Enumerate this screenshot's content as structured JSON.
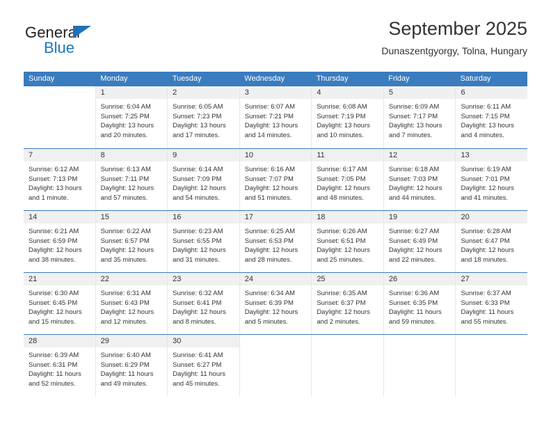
{
  "brand": {
    "name_part1": "General",
    "name_part2": "Blue",
    "triangle_icon": "triangle-icon",
    "accent_color": "#1878c4"
  },
  "header": {
    "title": "September 2025",
    "subtitle": "Dunaszentgyorgy, Tolna, Hungary"
  },
  "colors": {
    "header_blue": "#3a7cbe",
    "day_number_band": "#f0f0f0",
    "grid_line": "#e6e6e6",
    "text": "#333333"
  },
  "weekdays": [
    "Sunday",
    "Monday",
    "Tuesday",
    "Wednesday",
    "Thursday",
    "Friday",
    "Saturday"
  ],
  "weeks": [
    [
      {
        "day": "",
        "lines": []
      },
      {
        "day": "1",
        "lines": [
          "Sunrise: 6:04 AM",
          "Sunset: 7:25 PM",
          "Daylight: 13 hours",
          "and 20 minutes."
        ]
      },
      {
        "day": "2",
        "lines": [
          "Sunrise: 6:05 AM",
          "Sunset: 7:23 PM",
          "Daylight: 13 hours",
          "and 17 minutes."
        ]
      },
      {
        "day": "3",
        "lines": [
          "Sunrise: 6:07 AM",
          "Sunset: 7:21 PM",
          "Daylight: 13 hours",
          "and 14 minutes."
        ]
      },
      {
        "day": "4",
        "lines": [
          "Sunrise: 6:08 AM",
          "Sunset: 7:19 PM",
          "Daylight: 13 hours",
          "and 10 minutes."
        ]
      },
      {
        "day": "5",
        "lines": [
          "Sunrise: 6:09 AM",
          "Sunset: 7:17 PM",
          "Daylight: 13 hours",
          "and 7 minutes."
        ]
      },
      {
        "day": "6",
        "lines": [
          "Sunrise: 6:11 AM",
          "Sunset: 7:15 PM",
          "Daylight: 13 hours",
          "and 4 minutes."
        ]
      }
    ],
    [
      {
        "day": "7",
        "lines": [
          "Sunrise: 6:12 AM",
          "Sunset: 7:13 PM",
          "Daylight: 13 hours",
          "and 1 minute."
        ]
      },
      {
        "day": "8",
        "lines": [
          "Sunrise: 6:13 AM",
          "Sunset: 7:11 PM",
          "Daylight: 12 hours",
          "and 57 minutes."
        ]
      },
      {
        "day": "9",
        "lines": [
          "Sunrise: 6:14 AM",
          "Sunset: 7:09 PM",
          "Daylight: 12 hours",
          "and 54 minutes."
        ]
      },
      {
        "day": "10",
        "lines": [
          "Sunrise: 6:16 AM",
          "Sunset: 7:07 PM",
          "Daylight: 12 hours",
          "and 51 minutes."
        ]
      },
      {
        "day": "11",
        "lines": [
          "Sunrise: 6:17 AM",
          "Sunset: 7:05 PM",
          "Daylight: 12 hours",
          "and 48 minutes."
        ]
      },
      {
        "day": "12",
        "lines": [
          "Sunrise: 6:18 AM",
          "Sunset: 7:03 PM",
          "Daylight: 12 hours",
          "and 44 minutes."
        ]
      },
      {
        "day": "13",
        "lines": [
          "Sunrise: 6:19 AM",
          "Sunset: 7:01 PM",
          "Daylight: 12 hours",
          "and 41 minutes."
        ]
      }
    ],
    [
      {
        "day": "14",
        "lines": [
          "Sunrise: 6:21 AM",
          "Sunset: 6:59 PM",
          "Daylight: 12 hours",
          "and 38 minutes."
        ]
      },
      {
        "day": "15",
        "lines": [
          "Sunrise: 6:22 AM",
          "Sunset: 6:57 PM",
          "Daylight: 12 hours",
          "and 35 minutes."
        ]
      },
      {
        "day": "16",
        "lines": [
          "Sunrise: 6:23 AM",
          "Sunset: 6:55 PM",
          "Daylight: 12 hours",
          "and 31 minutes."
        ]
      },
      {
        "day": "17",
        "lines": [
          "Sunrise: 6:25 AM",
          "Sunset: 6:53 PM",
          "Daylight: 12 hours",
          "and 28 minutes."
        ]
      },
      {
        "day": "18",
        "lines": [
          "Sunrise: 6:26 AM",
          "Sunset: 6:51 PM",
          "Daylight: 12 hours",
          "and 25 minutes."
        ]
      },
      {
        "day": "19",
        "lines": [
          "Sunrise: 6:27 AM",
          "Sunset: 6:49 PM",
          "Daylight: 12 hours",
          "and 22 minutes."
        ]
      },
      {
        "day": "20",
        "lines": [
          "Sunrise: 6:28 AM",
          "Sunset: 6:47 PM",
          "Daylight: 12 hours",
          "and 18 minutes."
        ]
      }
    ],
    [
      {
        "day": "21",
        "lines": [
          "Sunrise: 6:30 AM",
          "Sunset: 6:45 PM",
          "Daylight: 12 hours",
          "and 15 minutes."
        ]
      },
      {
        "day": "22",
        "lines": [
          "Sunrise: 6:31 AM",
          "Sunset: 6:43 PM",
          "Daylight: 12 hours",
          "and 12 minutes."
        ]
      },
      {
        "day": "23",
        "lines": [
          "Sunrise: 6:32 AM",
          "Sunset: 6:41 PM",
          "Daylight: 12 hours",
          "and 8 minutes."
        ]
      },
      {
        "day": "24",
        "lines": [
          "Sunrise: 6:34 AM",
          "Sunset: 6:39 PM",
          "Daylight: 12 hours",
          "and 5 minutes."
        ]
      },
      {
        "day": "25",
        "lines": [
          "Sunrise: 6:35 AM",
          "Sunset: 6:37 PM",
          "Daylight: 12 hours",
          "and 2 minutes."
        ]
      },
      {
        "day": "26",
        "lines": [
          "Sunrise: 6:36 AM",
          "Sunset: 6:35 PM",
          "Daylight: 11 hours",
          "and 59 minutes."
        ]
      },
      {
        "day": "27",
        "lines": [
          "Sunrise: 6:37 AM",
          "Sunset: 6:33 PM",
          "Daylight: 11 hours",
          "and 55 minutes."
        ]
      }
    ],
    [
      {
        "day": "28",
        "lines": [
          "Sunrise: 6:39 AM",
          "Sunset: 6:31 PM",
          "Daylight: 11 hours",
          "and 52 minutes."
        ]
      },
      {
        "day": "29",
        "lines": [
          "Sunrise: 6:40 AM",
          "Sunset: 6:29 PM",
          "Daylight: 11 hours",
          "and 49 minutes."
        ]
      },
      {
        "day": "30",
        "lines": [
          "Sunrise: 6:41 AM",
          "Sunset: 6:27 PM",
          "Daylight: 11 hours",
          "and 45 minutes."
        ]
      },
      {
        "day": "",
        "lines": []
      },
      {
        "day": "",
        "lines": []
      },
      {
        "day": "",
        "lines": []
      },
      {
        "day": "",
        "lines": []
      }
    ]
  ]
}
